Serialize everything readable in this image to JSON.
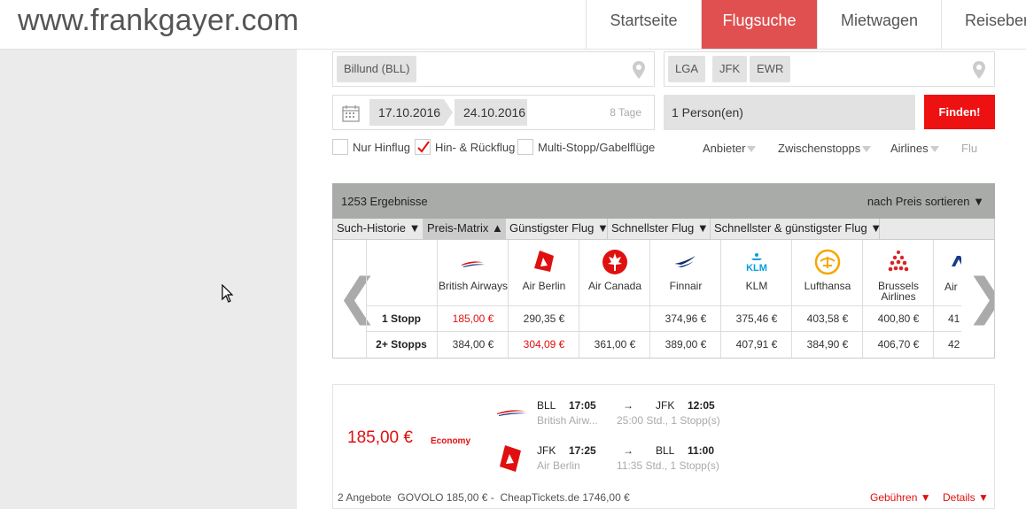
{
  "header": {
    "logo": "www.frankgayer.com",
    "nav": [
      "Startseite",
      "Flugsuche",
      "Mietwagen",
      "Reiseber"
    ],
    "active_index": 1
  },
  "search": {
    "origin_chip": "Billund (BLL)",
    "dest_chips": [
      "LGA",
      "JFK",
      "EWR"
    ],
    "date_from": "17.10.2016",
    "date_to": "24.10.2016",
    "days": "8 Tage",
    "persons": "1 Person(en)",
    "find_label": "Finden!",
    "options": [
      {
        "label": "Nur Hinflug",
        "checked": false
      },
      {
        "label": "Hin- & Rückflug",
        "checked": true
      },
      {
        "label": "Multi-Stopp/Gabelflüge",
        "checked": false
      }
    ],
    "filters": [
      "Anbieter",
      "Zwischenstopps",
      "Airlines",
      "Flu"
    ]
  },
  "results": {
    "count": "1253 Ergebnisse",
    "sort": "nach Preis sortieren ▼",
    "tabs": [
      "Such-Historie ▼",
      "Preis-Matrix ▲",
      "Günstigster Flug ▼",
      "Schnellster Flug ▼",
      "Schnellster & günstigster Flug ▼"
    ],
    "active_tab": 1
  },
  "matrix": {
    "row_labels": [
      "1 Stopp",
      "2+ Stopps"
    ],
    "airlines": [
      {
        "name": "British Airways",
        "logo": "british-airways-logo",
        "prices": [
          "185,00 €",
          "384,00 €"
        ],
        "red": [
          true,
          false
        ]
      },
      {
        "name": "Air Berlin",
        "logo": "air-berlin-logo",
        "prices": [
          "290,35 €",
          "304,09 €"
        ],
        "red": [
          false,
          true
        ]
      },
      {
        "name": "Air Canada",
        "logo": "air-canada-logo",
        "prices": [
          "",
          "361,00 €"
        ],
        "red": [
          false,
          false
        ]
      },
      {
        "name": "Finnair",
        "logo": "finnair-logo",
        "prices": [
          "374,96 €",
          "389,00 €"
        ],
        "red": [
          false,
          false
        ]
      },
      {
        "name": "KLM",
        "logo": "klm-logo",
        "prices": [
          "375,46 €",
          "407,91 €"
        ],
        "red": [
          false,
          false
        ]
      },
      {
        "name": "Lufthansa",
        "logo": "lufthansa-logo",
        "prices": [
          "403,58 €",
          "384,90 €"
        ],
        "red": [
          false,
          false
        ]
      },
      {
        "name": "Brussels Airlines",
        "logo": "brussels-airlines-logo",
        "prices": [
          "400,80 €",
          "406,70 €"
        ],
        "red": [
          false,
          false
        ]
      },
      {
        "name": "Air I",
        "logo": "air-logo",
        "prices": [
          "41",
          "42"
        ],
        "red": [
          false,
          false
        ]
      }
    ]
  },
  "offer": {
    "price": "185,00 €",
    "class": "Economy",
    "legs": [
      {
        "from": "BLL",
        "dep": "17:05",
        "arrow": "→",
        "to": "JFK",
        "arr": "12:05",
        "airline": "British Airw...",
        "info": "25:00 Std., 1 Stopp(s)"
      },
      {
        "from": "JFK",
        "dep": "17:25",
        "arrow": "→",
        "to": "BLL",
        "arr": "11:00",
        "airline": "Air Berlin",
        "info": "11:35 Std., 1 Stopp(s)"
      }
    ],
    "footer": "2 Angebote  GOVOLO 185,00 € -  CheapTickets.de 1746,00 €",
    "fees": "Gebühren ▼",
    "details": "Details ▼"
  }
}
